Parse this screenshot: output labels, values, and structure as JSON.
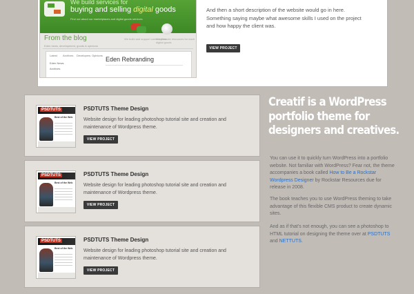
{
  "featured": {
    "screenshot": {
      "header_small": "We build services for",
      "header_line_a": "buying and selling ",
      "header_highlight": "digital",
      "header_line_b": " goods",
      "header_sub": "Find out about our marketplaces and digital goods services",
      "blog_heading": "From the blog",
      "blog_sub": "Eden news, development, goods & opinions",
      "feature_a": "We build and support communities",
      "feature_b": "We promote resources for each digital goods",
      "tab_1": "Latest",
      "tab_2": "Archives",
      "tab_3": "Developers",
      "tab_4": "Opinions",
      "news_label": "Eden News",
      "archive_label": "Archives",
      "article_title": "Eden Rebranding"
    },
    "description": "And then a short description of the website would go in here. Something saying maybe what awesome skills I used on the project and how happy the client was.",
    "button_label": "VIEW PROJECT"
  },
  "projects": [
    {
      "thumb_logo": "PSDTUTS",
      "thumb_title": "Best of the Web",
      "title": "PSDTUTS Theme Design",
      "description": "Website design for leading photoshop tutorial site and creation and maintenance of Wordpress theme.",
      "button_label": "VIEW PROJECT"
    },
    {
      "thumb_logo": "PSDTUTS",
      "thumb_title": "Best of the Web",
      "title": "PSDTUTS Theme Design",
      "description": "Website design for leading photoshop tutorial site and creation and maintenance of Wordpress theme.",
      "button_label": "VIEW PROJECT"
    },
    {
      "thumb_logo": "PSDTUTS",
      "thumb_title": "Best of the Web",
      "title": "PSDTUTS Theme Design",
      "description": "Website design for leading photoshop tutorial site and creation and maintenance of Wordpress theme.",
      "button_label": "VIEW PROJECT"
    }
  ],
  "sidebar": {
    "tagline": "Creatif is a WordPress portfolio theme for designers and creatives.",
    "p1_before": "You can use it to quickly turn WordPress into a portfolio website. Not familiar with WordPress? Fear not, the theme accompanies a book called ",
    "p1_link": "How to Be a Rockstar Wordpress Designer",
    "p1_after": " by Rockstar Resources due for release in 2008.",
    "p2": "The book teaches you to use WordPress theming to take advantage of this flexible CMS product to create dynamic sites.",
    "p3_before": "And as if that's not enough, you can see a photoshop to HTML tutorial on designing the theme over at ",
    "p3_link1": "PSDTUTS",
    "p3_and": " and ",
    "p3_link2": "NETTUTS",
    "p3_after": "."
  },
  "colors": {
    "page_bg": "#c2bcb7",
    "card_bg": "#e4e0dc",
    "button_bg": "#3a3a3a",
    "link": "#2a6fc2",
    "brand_green": "#57a336",
    "psdtuts_red": "#c2311f"
  }
}
